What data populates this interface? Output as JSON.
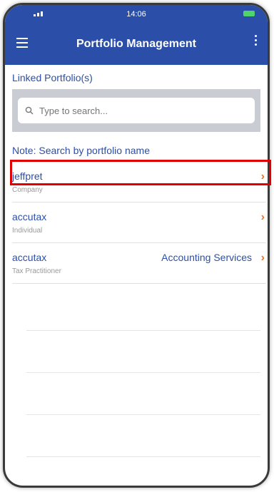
{
  "status_bar": {
    "time": "14:06"
  },
  "app_bar": {
    "title": "Portfolio Management",
    "menu_icon": "hamburger-menu-icon",
    "more_icon": "more-vertical-icon"
  },
  "section": {
    "title": "Linked Portfolio(s)"
  },
  "search": {
    "placeholder": "Type to search...",
    "icon": "search-icon"
  },
  "note": "Note: Search by portfolio name",
  "portfolios": [
    {
      "name": "jeffpret",
      "service": "",
      "type": "Company",
      "highlighted": true
    },
    {
      "name": "accutax",
      "service": "",
      "type": "Individual",
      "highlighted": false
    },
    {
      "name": "accutax",
      "service": "Accounting Services",
      "type": "Tax Practitioner",
      "highlighted": false
    }
  ],
  "colors": {
    "primary": "#2b4fa8",
    "accent": "#e8742a",
    "highlight": "#e00000"
  }
}
